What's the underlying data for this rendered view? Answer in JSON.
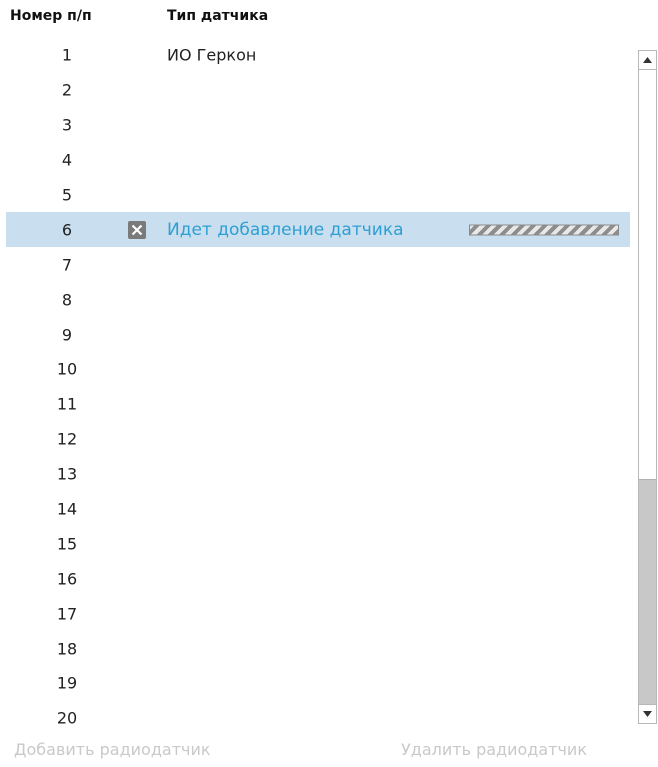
{
  "header": {
    "col_number": "Номер п/п",
    "col_type": "Тип датчика"
  },
  "rows": [
    {
      "num": "1",
      "type": "ИО Геркон"
    },
    {
      "num": "2",
      "type": ""
    },
    {
      "num": "3",
      "type": ""
    },
    {
      "num": "4",
      "type": ""
    },
    {
      "num": "5",
      "type": ""
    },
    {
      "num": "6",
      "type": "Идет добавление датчика"
    },
    {
      "num": "7",
      "type": ""
    },
    {
      "num": "8",
      "type": ""
    },
    {
      "num": "9",
      "type": ""
    },
    {
      "num": "10",
      "type": ""
    },
    {
      "num": "11",
      "type": ""
    },
    {
      "num": "12",
      "type": ""
    },
    {
      "num": "13",
      "type": ""
    },
    {
      "num": "14",
      "type": ""
    },
    {
      "num": "15",
      "type": ""
    },
    {
      "num": "16",
      "type": ""
    },
    {
      "num": "17",
      "type": ""
    },
    {
      "num": "18",
      "type": ""
    },
    {
      "num": "19",
      "type": ""
    },
    {
      "num": "20",
      "type": ""
    }
  ],
  "selected_row_index": 5,
  "footer": {
    "add_label": "Добавить радиодатчик",
    "delete_label": "Удалить радиодатчик"
  },
  "icons": {
    "delete": "close-icon",
    "scroll_up": "arrow-up-icon",
    "scroll_down": "arrow-down-icon"
  },
  "colors": {
    "selected_row_bg": "#c9deee",
    "in_progress_text": "#2e9fd3",
    "disabled_text": "#c9c9c9"
  }
}
